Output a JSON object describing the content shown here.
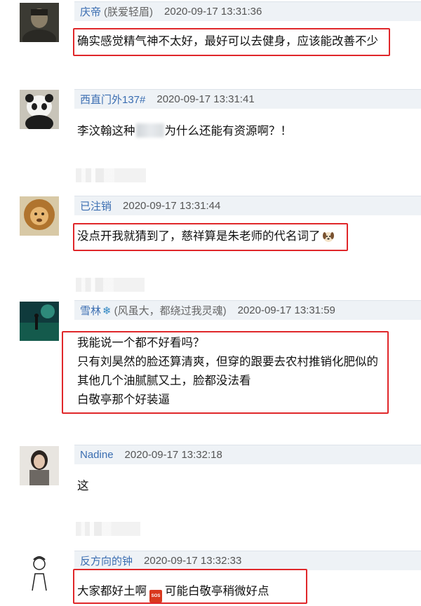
{
  "comments": [
    {
      "username": "庆帝",
      "note": "(朕爱轻眉)",
      "time": "2020-09-17 13:31:36",
      "lines": [
        "确实感觉精气神不太好，最好可以去健身，应该能改善不少"
      ]
    },
    {
      "username": "西直门外137#",
      "note": "",
      "time": "2020-09-17 13:31:41",
      "lines": [
        "李汶翰这种",
        "为什么还能有资源啊？！"
      ]
    },
    {
      "username": "已注销",
      "note": "",
      "time": "2020-09-17 13:31:44",
      "lines": [
        "没点开我就猜到了，慈祥算是朱老师的代名词了"
      ]
    },
    {
      "username": "雪林",
      "note": "(风虽大，都绕过我灵魂)",
      "time": "2020-09-17 13:31:59",
      "lines": [
        "我能说一个都不好看吗？",
        "只有刘昊然的脸还算清爽，但穿的跟要去农村推销化肥似的",
        "其他几个油腻腻又土，脸都没法看",
        "白敬亭那个好装逼"
      ]
    },
    {
      "username": "Nadine",
      "note": "",
      "time": "2020-09-17 13:32:18",
      "lines": [
        "这"
      ]
    },
    {
      "username": "反方向的钟",
      "note": "",
      "time": "2020-09-17 13:32:33",
      "lines": [
        "大家都好土啊",
        "可能白敬亭稍微好点"
      ]
    }
  ],
  "icons": {
    "snowflake": "❄",
    "sos_badge": "SOS"
  },
  "colors": {
    "highlight": "#e0272a",
    "username": "#3a6db1",
    "meta_bg": "#eef2f6"
  }
}
